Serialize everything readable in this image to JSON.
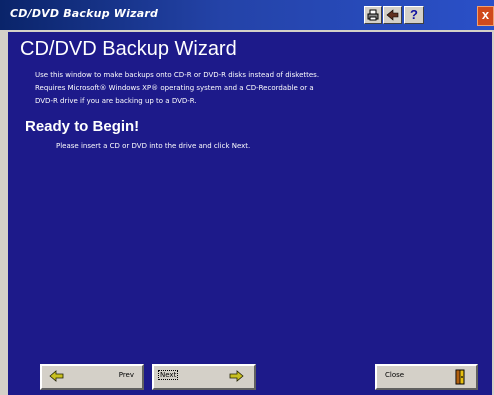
{
  "window": {
    "title": "CD/DVD Backup Wizard",
    "close_glyph": "x",
    "help_glyph": "?"
  },
  "toolbar_icons": [
    "print-icon",
    "arrow-icon",
    "help-icon"
  ],
  "main": {
    "title": "CD/DVD Backup Wizard",
    "description_line1": "Use this window to make backups onto CD-R or DVD-R disks instead of diskettes.",
    "description_line2": "Requires Microsoft® Windows XP® operating system and a CD-Recordable or a",
    "description_line3": "DVD-R drive if you are backing up to a DVD-R.",
    "section_title": "Ready to Begin!",
    "instruction": "Please insert a CD or DVD into the drive and click Next."
  },
  "buttons": {
    "prev": "Prev",
    "next": "Next",
    "close": "Close"
  },
  "colors": {
    "content_bg": "#1d1a8a",
    "titlebar": "#0a246a",
    "button_face": "#d4d0c8"
  }
}
